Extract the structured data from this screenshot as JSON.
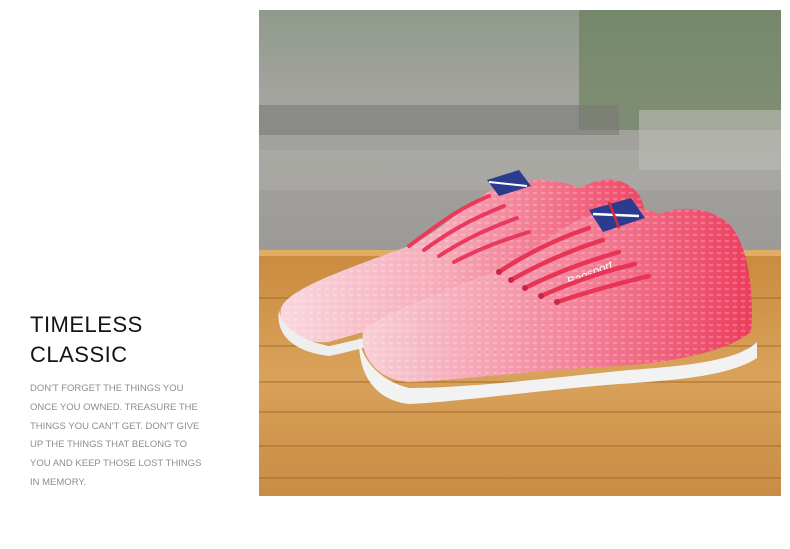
{
  "headline": {
    "line1": "TIMELESS",
    "line2": "CLASSIC"
  },
  "body_lines": [
    "DON'T FORGET THE THINGS YOU",
    "ONCE YOU OWNED. TREASURE THE",
    "THINGS YOU CAN'T GET. DON'T GIVE",
    "UP THE THINGS THAT BELONG TO",
    "YOU AND KEEP THOSE LOST THINGS",
    "IN MEMORY."
  ],
  "photo": {
    "brand_text": "Baosport",
    "description_icon": "sneaker-photo"
  },
  "colors": {
    "heading": "#141414",
    "body": "#8e8e8e",
    "shoe_pink": "#f04a6a",
    "shoe_light": "#f7c9d2",
    "table_wood": "#d49a4a"
  }
}
